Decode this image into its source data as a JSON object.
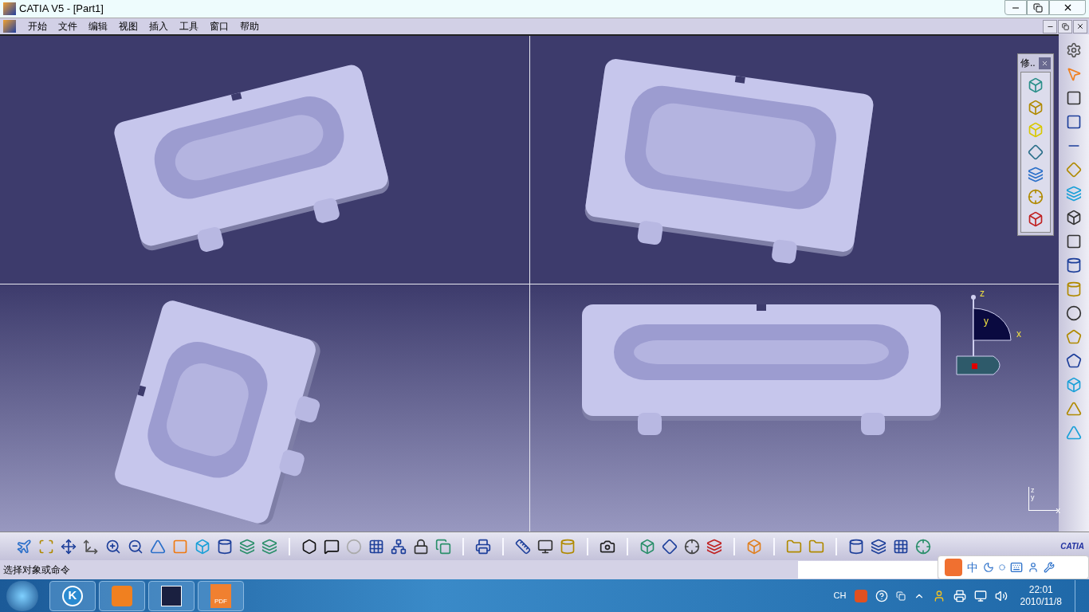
{
  "window": {
    "title": "CATIA V5 - [Part1]"
  },
  "menu": [
    "开始",
    "文件",
    "编辑",
    "视图",
    "插入",
    "工具",
    "窗口",
    "帮助"
  ],
  "floating_toolbar": {
    "title": "修.."
  },
  "compass": {
    "z": "z",
    "y": "y",
    "x": "x"
  },
  "axis_triad": {
    "z": "z",
    "y": "y",
    "x": "x"
  },
  "logo": {
    "text": "CATIA"
  },
  "status_bar": {
    "message": "选择对象或命令",
    "ime": "中"
  },
  "taskbar": {
    "apps": [
      {
        "label": "K",
        "selected": false
      },
      {
        "selected": false
      },
      {
        "selected": false
      },
      {
        "label": "PDF",
        "selected": false
      }
    ],
    "tray_language": "CH",
    "time": "22:01",
    "date": "2010/11/8"
  }
}
